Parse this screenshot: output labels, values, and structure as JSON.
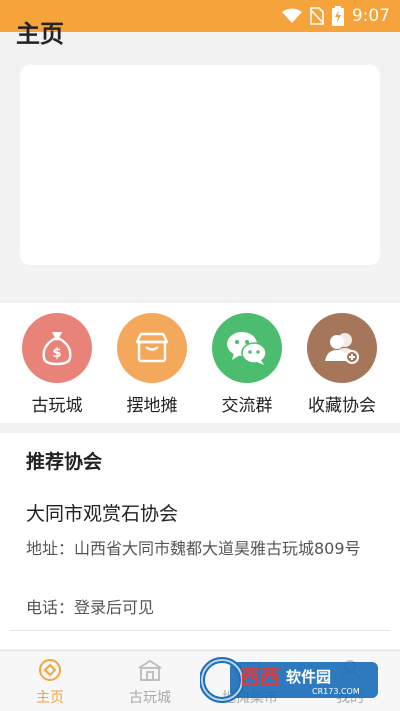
{
  "status_bar": {
    "time": "9:07",
    "icons": [
      "wifi-icon",
      "no-sim-icon",
      "battery-charging-icon"
    ]
  },
  "page": {
    "title": "主页"
  },
  "quick_links": [
    {
      "label": "古玩城",
      "icon": "money-bag-icon",
      "color": "#e9837a"
    },
    {
      "label": "摆地摊",
      "icon": "stall-icon",
      "color": "#f3a85c"
    },
    {
      "label": "交流群",
      "icon": "wechat-icon",
      "color": "#4cbc6e"
    },
    {
      "label": "收藏协会",
      "icon": "add-user-icon",
      "color": "#a6765a"
    }
  ],
  "recommended": {
    "title": "推荐协会",
    "item": {
      "name": "大同市观赏石协会",
      "address": "地址：山西省大同市魏都大道昊雅古玩城809号",
      "phone": "电话：登录后可见"
    }
  },
  "tabs": [
    {
      "label": "主页",
      "icon": "home-icon",
      "active": true
    },
    {
      "label": "古玩城",
      "icon": "building-icon",
      "active": false
    },
    {
      "label": "地摊集市",
      "icon": "market-icon",
      "active": false
    },
    {
      "label": "我的",
      "icon": "profile-icon",
      "active": false
    }
  ],
  "watermark": {
    "text": "西西软件园",
    "url_text": "CR173.COM"
  },
  "colors": {
    "accent": "#f5a33b",
    "background": "#f2f2f2"
  }
}
